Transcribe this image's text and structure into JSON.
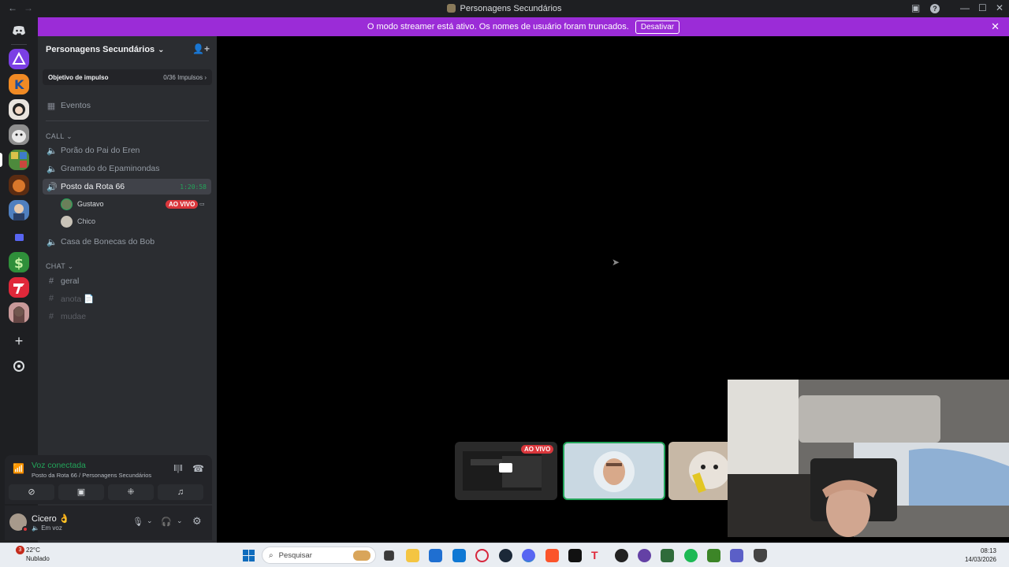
{
  "window": {
    "title": "Personagens Secundários",
    "nav_back": "←",
    "nav_forward": "→"
  },
  "banner": {
    "message": "O modo streamer está ativo. Os nomes de usuário foram truncados.",
    "button": "Desativar",
    "close": "✕"
  },
  "server": {
    "name": "Personagens Secundários",
    "chevron": "⌄",
    "boost_label": "Objetivo de impulso",
    "boost_value": "0/36 Impulsos ›"
  },
  "channels": {
    "events_label": "Eventos",
    "call_category": "CALL ⌄",
    "voice": [
      {
        "name": "Porão do Pai do Eren"
      },
      {
        "name": "Gramado do Epaminondas"
      },
      {
        "name": "Posto da Rota 66",
        "timer": "1:20:58",
        "active": true
      },
      {
        "name": "Casa de Bonecas do Bob"
      }
    ],
    "members": [
      {
        "name": "Gustavo",
        "badge": "AO VIVO"
      },
      {
        "name": "Chico"
      }
    ],
    "chat_category": "CHAT ⌄",
    "text": [
      {
        "name": "geral"
      },
      {
        "name": "anota 📄"
      },
      {
        "name": "mudae"
      }
    ]
  },
  "voice_panel": {
    "status": "Voz conectada",
    "location": "Posto da Rota 66 / Personagens Secundários"
  },
  "user": {
    "name": "Cicero 👌",
    "status": "Em voz"
  },
  "stage": {
    "live_badge": "AO VIVO"
  },
  "taskbar": {
    "weather_temp": "22°C",
    "weather_desc": "Nublado",
    "weather_badge": "3",
    "search_placeholder": "Pesquisar",
    "time": "08:13",
    "date": "14/03/2026"
  },
  "colors": {
    "accent_green": "#23a55a",
    "banner_purple": "#9b2cd7",
    "live_red": "#da373c"
  }
}
